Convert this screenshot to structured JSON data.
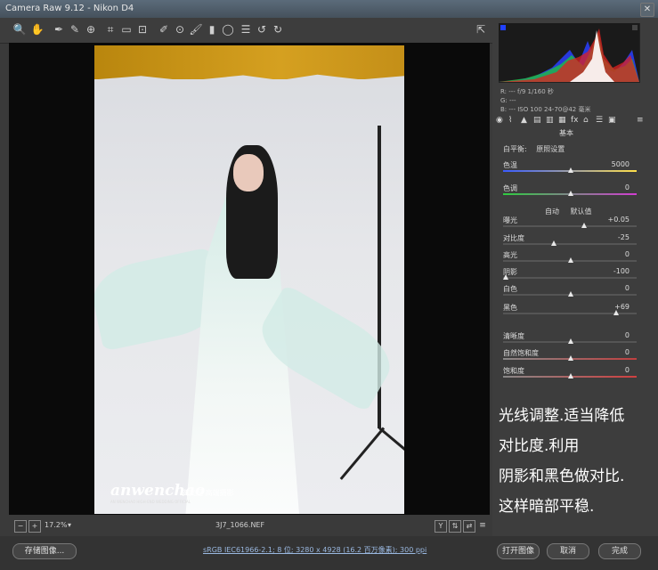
{
  "window": {
    "title": "Camera Raw 9.12 - Nikon D4"
  },
  "toolbar": {
    "tools": [
      "zoom-icon",
      "hand-icon",
      "white-balance-icon",
      "color-sampler-icon",
      "targeted-adjust-icon",
      "crop-icon",
      "straighten-icon",
      "transform-icon",
      "spot-removal-icon",
      "red-eye-icon",
      "adjustment-brush-icon",
      "graduated-filter-icon",
      "radial-filter-icon",
      "preferences-icon",
      "rotate-ccw-icon",
      "rotate-cw-icon"
    ],
    "export_icon": "open-in-photoshop-icon"
  },
  "photo": {
    "watermark": "anwenchao",
    "watermark_sub": "安文超  高端摄影",
    "watermark_tiny": "AN WENCHAO HIGH-END WEDDING OFFICIAL"
  },
  "histogram": {
    "colors": {
      "red": "#e82020",
      "green": "#20d040",
      "blue": "#3050ff",
      "white": "#ffffff"
    }
  },
  "camera_info": {
    "row1": "R: ---   f/9  1/160 秒",
    "row2": "G: ---",
    "row3": "B: ---   ISO 100  24-70@42 毫米"
  },
  "panel": {
    "title": "基本",
    "white_balance_label": "白平衡:",
    "white_balance_value": "原照设置",
    "tone_auto": "自动",
    "tone_default": "默认值",
    "sliders": [
      {
        "label": "色温",
        "value": "5000",
        "level": 0.5
      },
      {
        "label": "色调",
        "value": "0",
        "level": 0.5
      },
      {
        "label": "曝光",
        "value": "+0.05",
        "level": 0.6
      },
      {
        "label": "对比度",
        "value": "-25",
        "level": 0.37
      },
      {
        "label": "高光",
        "value": "0",
        "level": 0.5
      },
      {
        "label": "阴影",
        "value": "-100",
        "level": 0.0
      },
      {
        "label": "白色",
        "value": "0",
        "level": 0.5
      },
      {
        "label": "黑色",
        "value": "+69",
        "level": 0.85
      },
      {
        "label": "清晰度",
        "value": "0",
        "level": 0.5
      },
      {
        "label": "自然饱和度",
        "value": "0",
        "level": 0.5
      },
      {
        "label": "饱和度",
        "value": "0",
        "level": 0.5
      }
    ]
  },
  "overlay": {
    "lines": [
      "光线调整.适当降低",
      "对比度.利用",
      "阴影和黑色做对比.",
      "这样暗部平稳."
    ]
  },
  "status": {
    "zoom": "17.2%",
    "filename": "3J7_1066.NEF"
  },
  "bottom": {
    "save_label": "存储图像...",
    "workflow": "sRGB IEC61966-2.1; 8 位; 3280 x 4928 (16.2 百万像素); 300 ppi",
    "open_label": "打开图像",
    "cancel_label": "取消",
    "done_label": "完成"
  }
}
